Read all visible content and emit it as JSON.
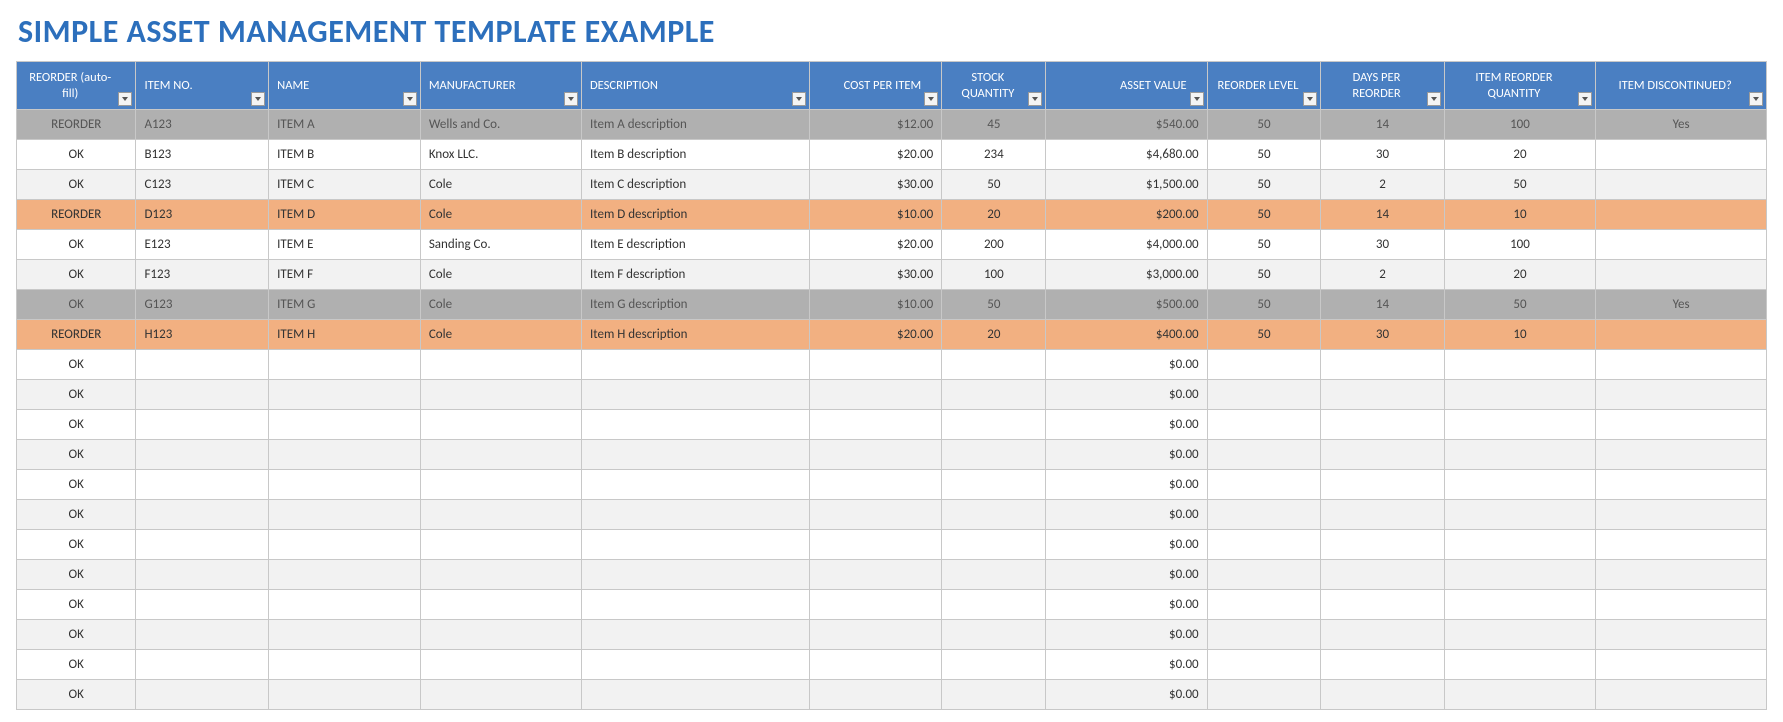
{
  "title": "SIMPLE ASSET MANAGEMENT TEMPLATE EXAMPLE",
  "columns": [
    {
      "key": "reorder",
      "label": "REORDER (auto-fill)",
      "cls": "col-reorder"
    },
    {
      "key": "item_no",
      "label": "ITEM NO.",
      "cls": "col-itemno"
    },
    {
      "key": "name",
      "label": "NAME",
      "cls": "col-name"
    },
    {
      "key": "mfr",
      "label": "MANUFACTURER",
      "cls": "col-mfr"
    },
    {
      "key": "desc",
      "label": "DESCRIPTION",
      "cls": "col-desc"
    },
    {
      "key": "cost",
      "label": "COST PER ITEM",
      "cls": "col-cost"
    },
    {
      "key": "stock",
      "label": "STOCK QUANTITY",
      "cls": "col-stock"
    },
    {
      "key": "asset",
      "label": "ASSET VALUE",
      "cls": "col-asset"
    },
    {
      "key": "level",
      "label": "REORDER LEVEL",
      "cls": "col-level"
    },
    {
      "key": "days",
      "label": "DAYS PER REORDER",
      "cls": "col-days"
    },
    {
      "key": "reqty",
      "label": "ITEM REORDER QUANTITY",
      "cls": "col-reqty"
    },
    {
      "key": "disc",
      "label": "ITEM DISCONTINUED?",
      "cls": "col-disc"
    }
  ],
  "rows": [
    {
      "style": "gray",
      "reorder": "REORDER",
      "item_no": "A123",
      "name": "ITEM A",
      "mfr": "Wells and Co.",
      "desc": "Item A description",
      "cost": "$12.00",
      "stock": "45",
      "asset": "$540.00",
      "level": "50",
      "days": "14",
      "reqty": "100",
      "disc": "Yes"
    },
    {
      "style": "",
      "reorder": "OK",
      "item_no": "B123",
      "name": "ITEM B",
      "mfr": "Knox LLC.",
      "desc": "Item B description",
      "cost": "$20.00",
      "stock": "234",
      "asset": "$4,680.00",
      "level": "50",
      "days": "30",
      "reqty": "20",
      "disc": ""
    },
    {
      "style": "alt",
      "reorder": "OK",
      "item_no": "C123",
      "name": "ITEM C",
      "mfr": "Cole",
      "desc": "Item C description",
      "cost": "$30.00",
      "stock": "50",
      "asset": "$1,500.00",
      "level": "50",
      "days": "2",
      "reqty": "50",
      "disc": ""
    },
    {
      "style": "orange",
      "reorder": "REORDER",
      "item_no": "D123",
      "name": "ITEM D",
      "mfr": "Cole",
      "desc": "Item D description",
      "cost": "$10.00",
      "stock": "20",
      "asset": "$200.00",
      "level": "50",
      "days": "14",
      "reqty": "10",
      "disc": ""
    },
    {
      "style": "",
      "reorder": "OK",
      "item_no": "E123",
      "name": "ITEM E",
      "mfr": "Sanding Co.",
      "desc": "Item E description",
      "cost": "$20.00",
      "stock": "200",
      "asset": "$4,000.00",
      "level": "50",
      "days": "30",
      "reqty": "100",
      "disc": ""
    },
    {
      "style": "alt",
      "reorder": "OK",
      "item_no": "F123",
      "name": "ITEM F",
      "mfr": "Cole",
      "desc": "Item F description",
      "cost": "$30.00",
      "stock": "100",
      "asset": "$3,000.00",
      "level": "50",
      "days": "2",
      "reqty": "20",
      "disc": ""
    },
    {
      "style": "gray",
      "reorder": "OK",
      "item_no": "G123",
      "name": "ITEM G",
      "mfr": "Cole",
      "desc": "Item G description",
      "cost": "$10.00",
      "stock": "50",
      "asset": "$500.00",
      "level": "50",
      "days": "14",
      "reqty": "50",
      "disc": "Yes"
    },
    {
      "style": "orange",
      "reorder": "REORDER",
      "item_no": "H123",
      "name": "ITEM H",
      "mfr": "Cole",
      "desc": "Item H description",
      "cost": "$20.00",
      "stock": "20",
      "asset": "$400.00",
      "level": "50",
      "days": "30",
      "reqty": "10",
      "disc": ""
    },
    {
      "style": "",
      "reorder": "OK",
      "item_no": "",
      "name": "",
      "mfr": "",
      "desc": "",
      "cost": "",
      "stock": "",
      "asset": "$0.00",
      "level": "",
      "days": "",
      "reqty": "",
      "disc": ""
    },
    {
      "style": "alt",
      "reorder": "OK",
      "item_no": "",
      "name": "",
      "mfr": "",
      "desc": "",
      "cost": "",
      "stock": "",
      "asset": "$0.00",
      "level": "",
      "days": "",
      "reqty": "",
      "disc": ""
    },
    {
      "style": "",
      "reorder": "OK",
      "item_no": "",
      "name": "",
      "mfr": "",
      "desc": "",
      "cost": "",
      "stock": "",
      "asset": "$0.00",
      "level": "",
      "days": "",
      "reqty": "",
      "disc": ""
    },
    {
      "style": "alt",
      "reorder": "OK",
      "item_no": "",
      "name": "",
      "mfr": "",
      "desc": "",
      "cost": "",
      "stock": "",
      "asset": "$0.00",
      "level": "",
      "days": "",
      "reqty": "",
      "disc": ""
    },
    {
      "style": "",
      "reorder": "OK",
      "item_no": "",
      "name": "",
      "mfr": "",
      "desc": "",
      "cost": "",
      "stock": "",
      "asset": "$0.00",
      "level": "",
      "days": "",
      "reqty": "",
      "disc": ""
    },
    {
      "style": "alt",
      "reorder": "OK",
      "item_no": "",
      "name": "",
      "mfr": "",
      "desc": "",
      "cost": "",
      "stock": "",
      "asset": "$0.00",
      "level": "",
      "days": "",
      "reqty": "",
      "disc": ""
    },
    {
      "style": "",
      "reorder": "OK",
      "item_no": "",
      "name": "",
      "mfr": "",
      "desc": "",
      "cost": "",
      "stock": "",
      "asset": "$0.00",
      "level": "",
      "days": "",
      "reqty": "",
      "disc": ""
    },
    {
      "style": "alt",
      "reorder": "OK",
      "item_no": "",
      "name": "",
      "mfr": "",
      "desc": "",
      "cost": "",
      "stock": "",
      "asset": "$0.00",
      "level": "",
      "days": "",
      "reqty": "",
      "disc": ""
    },
    {
      "style": "",
      "reorder": "OK",
      "item_no": "",
      "name": "",
      "mfr": "",
      "desc": "",
      "cost": "",
      "stock": "",
      "asset": "$0.00",
      "level": "",
      "days": "",
      "reqty": "",
      "disc": ""
    },
    {
      "style": "alt",
      "reorder": "OK",
      "item_no": "",
      "name": "",
      "mfr": "",
      "desc": "",
      "cost": "",
      "stock": "",
      "asset": "$0.00",
      "level": "",
      "days": "",
      "reqty": "",
      "disc": ""
    },
    {
      "style": "",
      "reorder": "OK",
      "item_no": "",
      "name": "",
      "mfr": "",
      "desc": "",
      "cost": "",
      "stock": "",
      "asset": "$0.00",
      "level": "",
      "days": "",
      "reqty": "",
      "disc": ""
    },
    {
      "style": "alt",
      "reorder": "OK",
      "item_no": "",
      "name": "",
      "mfr": "",
      "desc": "",
      "cost": "",
      "stock": "",
      "asset": "$0.00",
      "level": "",
      "days": "",
      "reqty": "",
      "disc": ""
    }
  ]
}
